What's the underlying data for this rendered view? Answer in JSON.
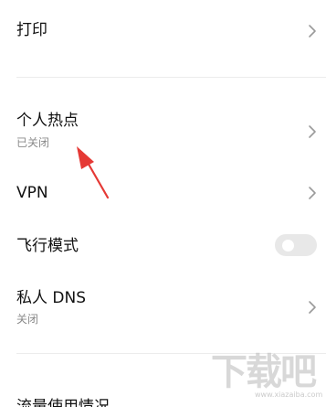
{
  "settings": {
    "items": [
      {
        "label": "打印"
      },
      {
        "label": "个人热点",
        "status": "已关闭"
      },
      {
        "label": "VPN"
      },
      {
        "label": "飞行模式",
        "toggle": false
      },
      {
        "label": "私人 DNS",
        "status": "关闭"
      },
      {
        "label": "流量使用情况"
      }
    ]
  },
  "watermark": {
    "url": "www.xiazaiba.com"
  },
  "colors": {
    "arrow": "#e53935",
    "toggle_off": "#e8e8e8",
    "subtitle": "#8a8a8a"
  }
}
